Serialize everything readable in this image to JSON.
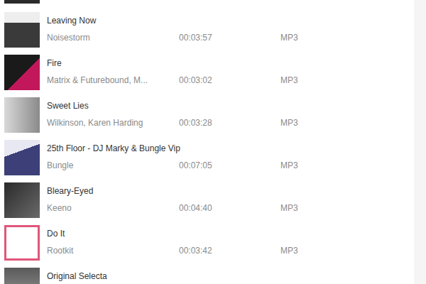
{
  "tracks": [
    {
      "title": "Leaving Now",
      "artist": "Noisestorm",
      "duration": "00:03:57",
      "format": "MP3"
    },
    {
      "title": "Fire",
      "artist": "Matrix & Futurebound, M...",
      "duration": "00:03:02",
      "format": "MP3"
    },
    {
      "title": "Sweet Lies",
      "artist": "Wilkinson, Karen Harding",
      "duration": "00:03:28",
      "format": "MP3"
    },
    {
      "title": "25th Floor - DJ Marky & Bungle Vip",
      "artist": "Bungle",
      "duration": "00:07:05",
      "format": "MP3"
    },
    {
      "title": "Bleary-Eyed",
      "artist": "Keeno",
      "duration": "00:04:40",
      "format": "MP3"
    },
    {
      "title": "Do It",
      "artist": "Rootkit",
      "duration": "00:03:42",
      "format": "MP3"
    },
    {
      "title": "Original Selecta"
    }
  ]
}
